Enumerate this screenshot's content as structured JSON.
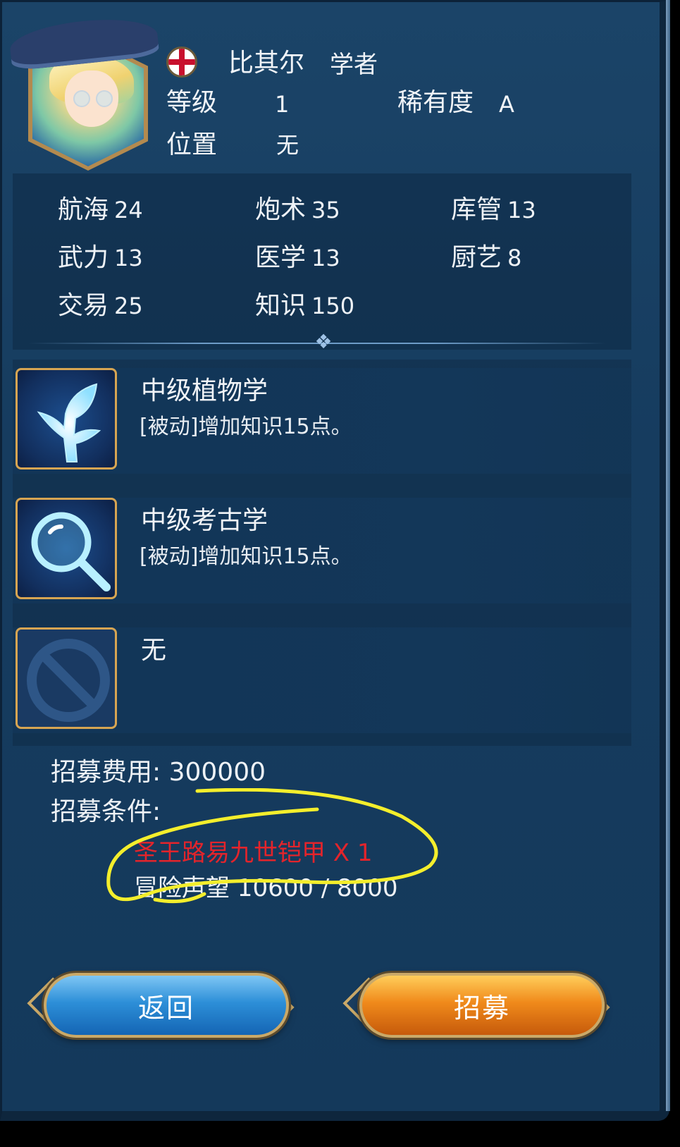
{
  "character": {
    "name": "比其尔",
    "job": "学者",
    "level_label": "等级",
    "level": "1",
    "rarity_label": "稀有度",
    "rarity": "A",
    "position_label": "位置",
    "position": "无"
  },
  "stats": [
    {
      "label": "航海",
      "value": "24"
    },
    {
      "label": "炮术",
      "value": "35"
    },
    {
      "label": "库管",
      "value": "13"
    },
    {
      "label": "武力",
      "value": "13"
    },
    {
      "label": "医学",
      "value": "13"
    },
    {
      "label": "厨艺",
      "value": "8"
    },
    {
      "label": "交易",
      "value": "25"
    },
    {
      "label": "知识",
      "value": "150"
    }
  ],
  "skills": [
    {
      "title": "中级植物学",
      "desc": "[被动]增加知识15点。",
      "icon": "plant-icon"
    },
    {
      "title": "中级考古学",
      "desc": "[被动]增加知识15点。",
      "icon": "magnifier-icon"
    },
    {
      "title": "无",
      "desc": "",
      "icon": "forbidden-icon"
    }
  ],
  "recruit": {
    "cost_label": "招募费用: 300000",
    "cond_label": "招募条件:",
    "req_item": "圣王路易九世铠甲 X 1",
    "req_fame": "冒险声望 10600 / 8000"
  },
  "buttons": {
    "back": "返回",
    "recruit": "招募"
  },
  "colors": {
    "panel": "#163c5f",
    "gold_border": "#d7a552",
    "requirement_red": "#e3242b",
    "annotation_yellow": "#f4ee2c"
  }
}
